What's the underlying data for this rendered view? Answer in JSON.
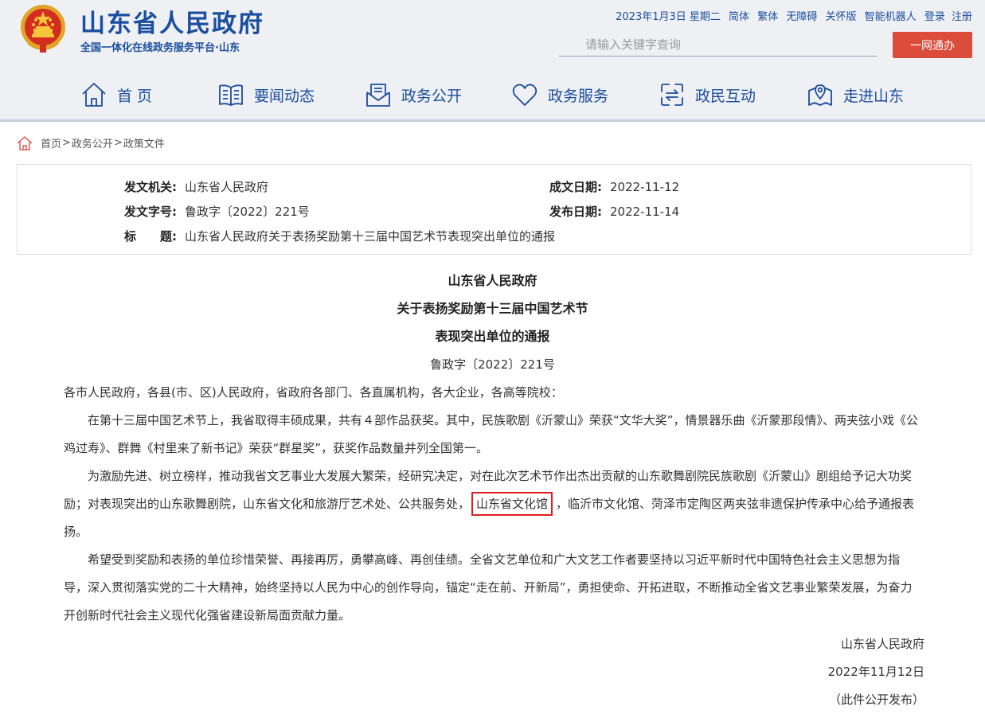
{
  "header": {
    "site_title": "山东省人民政府",
    "site_subtitle": "全国一体化在线政务服务平台·山东",
    "date_text": "2023年1月3日 星期二",
    "links": [
      "简体",
      "繁体",
      "无障碍",
      "关怀版",
      "智能机器人",
      "登录",
      "注册"
    ],
    "search_placeholder": "请输入关键字查询",
    "yiwang_button": "一网通办"
  },
  "nav": [
    {
      "label": "首 页",
      "icon": "home-icon"
    },
    {
      "label": "要闻动态",
      "icon": "book-icon"
    },
    {
      "label": "政务公开",
      "icon": "mail-doc-icon"
    },
    {
      "label": "政务服务",
      "icon": "heart-icon"
    },
    {
      "label": "政民互动",
      "icon": "exchange-icon"
    },
    {
      "label": "走进山东",
      "icon": "map-pin-icon"
    }
  ],
  "breadcrumb": {
    "items": [
      "首页",
      "政务公开",
      "政策文件"
    ],
    "separator": ">"
  },
  "meta": {
    "issuer_label": "发文机关:",
    "issuer": "山东省人民政府",
    "number_label": "发文字号:",
    "number": "鲁政字〔2022〕221号",
    "title_label": "标　　题:",
    "title": "山东省人民政府关于表扬奖励第十三届中国艺术节表现突出单位的通报",
    "made_date_label": "成文日期:",
    "made_date": "2022-11-12",
    "publish_date_label": "发布日期:",
    "publish_date": "2022-11-14"
  },
  "document": {
    "title_lines": [
      "山东省人民政府",
      "关于表扬奖励第十三届中国艺术节",
      "表现突出单位的通报"
    ],
    "doc_number": "鲁政字〔2022〕221号",
    "salutation": "各市人民政府，各县(市、区)人民政府，省政府各部门、各直属机构，各大企业，各高等院校：",
    "p1": "在第十三届中国艺术节上，我省取得丰硕成果，共有４部作品获奖。其中，民族歌剧《沂蒙山》荣获“文华大奖”，情景器乐曲《沂蒙那段情》、两夹弦小戏《公鸡过寿》、群舞《村里来了新书记》荣获“群星奖”，获奖作品数量并列全国第一。",
    "p2_before": "为激励先进、树立榜样，推动我省文艺事业大发展大繁荣，经研究决定，对在此次艺术节作出杰出贡献的山东歌舞剧院民族歌剧《沂蒙山》剧组给予记大功奖励；对表现突出的山东歌舞剧院，山东省文化和旅游厅艺术处、公共服务处，",
    "p2_highlight": "山东省文化馆",
    "p2_after": "，临沂市文化馆、菏泽市定陶区两夹弦非遗保护传承中心给予通报表扬。",
    "p3": "希望受到奖励和表扬的单位珍惜荣誉、再接再厉，勇攀高峰、再创佳绩。全省文艺单位和广大文艺工作者要坚持以习近平新时代中国特色社会主义思想为指导，深入贯彻落实党的二十大精神，始终坚持以人民为中心的创作导向，锚定“走在前、开新局”，勇担使命、开拓进取，不断推动全省文艺事业繁荣发展，为奋力开创新时代社会主义现代化强省建设新局面贡献力量。",
    "signature": "山东省人民政府",
    "sign_date": "2022年11月12日",
    "release_note": "（此件公开发布）"
  },
  "colors": {
    "brand_blue": "#1a4e9e",
    "header_bg": "#eef0f4",
    "button_red": "#db4d3a",
    "highlight_red": "#e02020"
  }
}
